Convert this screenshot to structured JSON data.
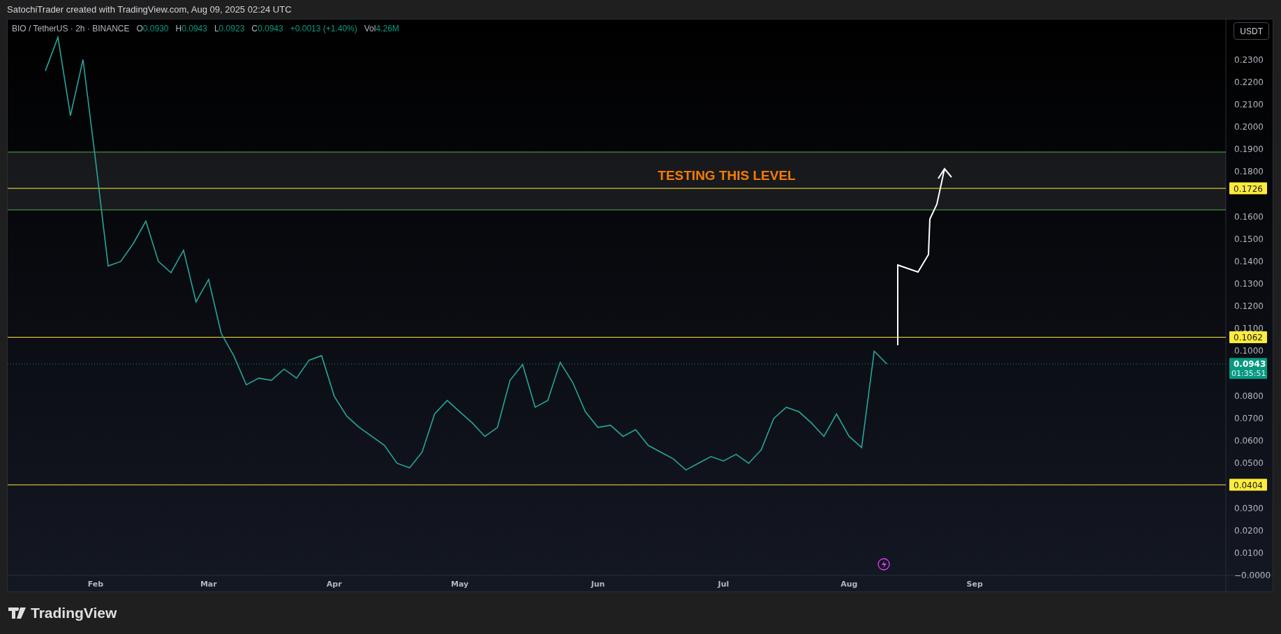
{
  "header": {
    "attribution": "SatochiTrader created with TradingView.com, Aug 09, 2025 02:24 UTC"
  },
  "legend": {
    "symbol": "BIO / TetherUS · 2h · BINANCE",
    "fields": [
      {
        "label": "O",
        "value": "0.0930"
      },
      {
        "label": "H",
        "value": "0.0943"
      },
      {
        "label": "L",
        "value": "0.0923"
      },
      {
        "label": "C",
        "value": "0.0943"
      }
    ],
    "change": "+0.0013 (+1.40%)",
    "volume": {
      "label": "Vol",
      "value": "4.26M"
    }
  },
  "currency_button": "USDT",
  "chart": {
    "chart_data": {
      "type": "line",
      "categories": [
        null,
        null,
        null,
        null,
        null,
        null,
        null,
        "Feb",
        null,
        null,
        null,
        null,
        null,
        null,
        null,
        null,
        "Mar",
        null,
        null,
        null,
        null,
        null,
        null,
        null,
        null,
        null,
        "Apr",
        null,
        null,
        null,
        null,
        null,
        null,
        null,
        null,
        null,
        "May",
        null,
        null,
        null,
        null,
        null,
        null,
        null,
        null,
        null,
        null,
        "Jun",
        null,
        null,
        null,
        null,
        null,
        null,
        null,
        null,
        null,
        "Jul",
        null,
        null,
        null,
        null,
        null,
        null,
        null,
        null,
        null,
        "Aug",
        null,
        null,
        null,
        null,
        null,
        null,
        null,
        null,
        null,
        "Sep",
        null,
        null,
        null,
        null,
        null,
        null,
        null,
        null,
        null,
        null,
        null,
        null,
        null,
        null,
        null,
        null,
        null,
        null,
        null,
        null
      ],
      "series": [
        {
          "color": "#26a69a",
          "values": [
            null,
            null,
            null,
            0.225,
            0.24,
            0.205,
            0.23,
            0.185,
            0.138,
            0.14,
            0.148,
            0.158,
            0.14,
            0.135,
            0.145,
            0.122,
            0.132,
            0.108,
            0.098,
            0.085,
            0.088,
            0.087,
            0.092,
            0.088,
            0.096,
            0.098,
            0.08,
            0.071,
            0.066,
            0.062,
            0.058,
            0.05,
            0.048,
            0.055,
            0.072,
            0.078,
            0.073,
            0.068,
            0.062,
            0.066,
            0.087,
            0.094,
            0.075,
            0.078,
            0.095,
            0.086,
            0.073,
            0.066,
            0.067,
            0.062,
            0.065,
            0.058,
            0.055,
            0.052,
            0.047,
            0.05,
            0.053,
            0.051,
            0.054,
            0.05,
            0.056,
            0.07,
            0.075,
            0.073,
            0.068,
            0.062,
            0.072,
            0.062,
            0.057,
            0.1,
            0.0943,
            null,
            null,
            null,
            null,
            null,
            null,
            null,
            null,
            null,
            null,
            null,
            null,
            null,
            null,
            null,
            null,
            null,
            null,
            null,
            null,
            null,
            null,
            null,
            null,
            null,
            null,
            null
          ]
        }
      ],
      "ylim": [
        0,
        0.2479
      ],
      "yticks": [
        {
          "value": 0,
          "label": "−0.0000"
        },
        {
          "value": 0.01,
          "label": "0.0100"
        },
        {
          "value": 0.02,
          "label": "0.0200"
        },
        {
          "value": 0.03,
          "label": "0.0300"
        },
        {
          "value": 0.05,
          "label": "0.0500"
        },
        {
          "value": 0.06,
          "label": "0.0600"
        },
        {
          "value": 0.07,
          "label": "0.0700"
        },
        {
          "value": 0.08,
          "label": "0.0800"
        },
        {
          "value": 0.1,
          "label": "0.1000"
        },
        {
          "value": 0.11,
          "label": "0.1100"
        },
        {
          "value": 0.12,
          "label": "0.1200"
        },
        {
          "value": 0.13,
          "label": "0.1300"
        },
        {
          "value": 0.14,
          "label": "0.1400"
        },
        {
          "value": 0.15,
          "label": "0.1500"
        },
        {
          "value": 0.16,
          "label": "0.1600"
        },
        {
          "value": 0.18,
          "label": "0.1800"
        },
        {
          "value": 0.19,
          "label": "0.1900"
        },
        {
          "value": 0.2,
          "label": "0.2000"
        },
        {
          "value": 0.21,
          "label": "0.2100"
        },
        {
          "value": 0.22,
          "label": "0.2200"
        },
        {
          "value": 0.23,
          "label": "0.2300"
        }
      ],
      "bands": [
        {
          "axis": "y",
          "from": 0.163,
          "to": 0.1888
        }
      ],
      "ref_lines": [
        {
          "axis": "y",
          "value": 0.1888,
          "color": "#4caf50"
        },
        {
          "axis": "y",
          "value": 0.163,
          "color": "#4caf50"
        },
        {
          "axis": "y",
          "value": 0.1726,
          "color": "#ffeb3b",
          "label": "0.1726"
        },
        {
          "axis": "y",
          "value": 0.1062,
          "color": "#ffeb3b",
          "label": "0.1062"
        },
        {
          "axis": "y",
          "value": 0.0404,
          "color": "#ffeb3b",
          "label": "0.0404"
        },
        {
          "axis": "y",
          "value": 0.0943,
          "color": "#089981",
          "label": "0.0943"
        }
      ],
      "annotations": [
        "TESTING THIS LEVEL"
      ]
    },
    "last_price": {
      "countdown": "01:35:51"
    }
  },
  "footer": {
    "logo": "TradingView"
  }
}
